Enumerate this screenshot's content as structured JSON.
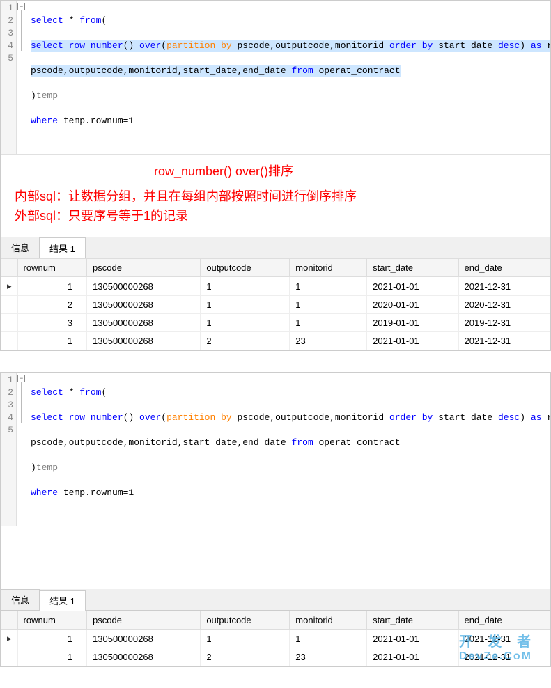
{
  "sql": {
    "lines": [
      1,
      2,
      3,
      4,
      5
    ],
    "l1_select": "select",
    "l1_rest": " * ",
    "l1_from": "from",
    "l1_paren": "(",
    "l2_select": "select",
    "l2_sp1": " ",
    "l2_fn": "row_number",
    "l2_p1": "() ",
    "l2_over": "over",
    "l2_p2": "(",
    "l2_part": "partition by",
    "l2_cols1": " pscode,outputcode,monitorid ",
    "l2_order": "order by",
    "l2_sd": " start_date ",
    "l2_desc": "desc",
    "l2_p3": ") ",
    "l2_as": "as",
    "l2_rn": " rownum,",
    "l3_cols": "pscode,outputcode,monitorid,start_date,end_date ",
    "l3_from": "from",
    "l3_tbl": " operat_contract",
    "l4_p": ")",
    "l4_temp": "temp",
    "l5_where": "where",
    "l5_cond": " temp.rownum=1"
  },
  "annotation": {
    "title": "row_number()   over()排序",
    "inner": "内部sql：让数据分组，并且在每组内部按照时间进行倒序排序",
    "outer": "外部sql：只要序号等于1的记录"
  },
  "tabs": {
    "info": "信息",
    "result": "结果 1"
  },
  "columns": {
    "rownum": "rownum",
    "pscode": "pscode",
    "outputcode": "outputcode",
    "monitorid": "monitorid",
    "start_date": "start_date",
    "end_date": "end_date"
  },
  "grid1": [
    {
      "rownum": "1",
      "pscode": "130500000268",
      "outputcode": "1",
      "monitorid": "1",
      "start_date": "2021-01-01",
      "end_date": "2021-12-31"
    },
    {
      "rownum": "2",
      "pscode": "130500000268",
      "outputcode": "1",
      "monitorid": "1",
      "start_date": "2020-01-01",
      "end_date": "2020-12-31"
    },
    {
      "rownum": "3",
      "pscode": "130500000268",
      "outputcode": "1",
      "monitorid": "1",
      "start_date": "2019-01-01",
      "end_date": "2019-12-31"
    },
    {
      "rownum": "1",
      "pscode": "130500000268",
      "outputcode": "2",
      "monitorid": "23",
      "start_date": "2021-01-01",
      "end_date": "2021-12-31"
    }
  ],
  "grid2": [
    {
      "rownum": "1",
      "pscode": "130500000268",
      "outputcode": "1",
      "monitorid": "1",
      "start_date": "2021-01-01",
      "end_date": "2021-12-31"
    },
    {
      "rownum": "1",
      "pscode": "130500000268",
      "outputcode": "2",
      "monitorid": "23",
      "start_date": "2021-01-01",
      "end_date": "2021-12-31"
    }
  ],
  "watermark": {
    "line1": "开 发 者",
    "line2": "DevZe.CoM"
  }
}
